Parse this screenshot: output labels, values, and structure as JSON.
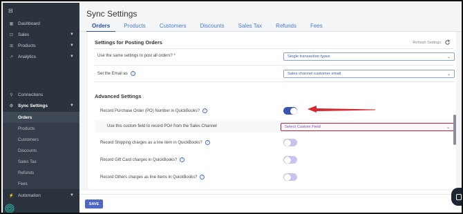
{
  "sidebar": {
    "items": [
      {
        "label": "Dashboard",
        "icon": "dashboard-icon",
        "glyph": "▦"
      },
      {
        "label": "Sales",
        "icon": "tag-icon",
        "glyph": "⊡"
      },
      {
        "label": "Products",
        "icon": "box-icon",
        "glyph": "⊞"
      },
      {
        "label": "Analytics",
        "icon": "trend-icon",
        "glyph": "↗"
      }
    ],
    "connections": {
      "label": "Connections",
      "glyph": "⚲"
    },
    "sync_settings": {
      "label": "Sync Settings",
      "glyph": "⚙"
    },
    "sub_items": [
      "Orders",
      "Products",
      "Customers",
      "Discounts",
      "Sales Tax",
      "Refunds",
      "Fees"
    ],
    "automation": {
      "label": "Automation",
      "glyph": "⚡"
    }
  },
  "header": {
    "title": "Sync Settings",
    "tabs": [
      "Orders",
      "Products",
      "Customers",
      "Discounts",
      "Sales Tax",
      "Refunds",
      "Fees"
    ],
    "active_tab": "Orders"
  },
  "posting": {
    "title": "Settings for Posting Orders",
    "refresh_label": "Refresh Settings",
    "same_settings_label": "Use the same settings to post all orders? *",
    "same_settings_value": "Single transaction types",
    "email_label": "Set the Email as",
    "email_value": "Sales channel customer email"
  },
  "advanced": {
    "title": "Advanced Settings",
    "po_label": "Record Purchase Order (PO) Number in QuickBooks?",
    "po_enabled": true,
    "custom_field_label": "Use this custom field to record PO# from the Sales Channel",
    "custom_field_placeholder": "Select Custom Field",
    "shipping_label": "Record Shipping charges as a line item in QuickBooks?",
    "shipping_enabled": false,
    "giftcard_label": "Record Gift Card charges in QuickBooks?",
    "giftcard_enabled": false,
    "others_label": "Record Others charges as line items in QuickBooks?",
    "others_enabled": false
  },
  "footer": {
    "save_label": "SAVE"
  },
  "colors": {
    "sidebar": "#2b333e",
    "accent": "#3c55b0",
    "highlight": "#b0273c",
    "arrow": "#d9262c"
  }
}
